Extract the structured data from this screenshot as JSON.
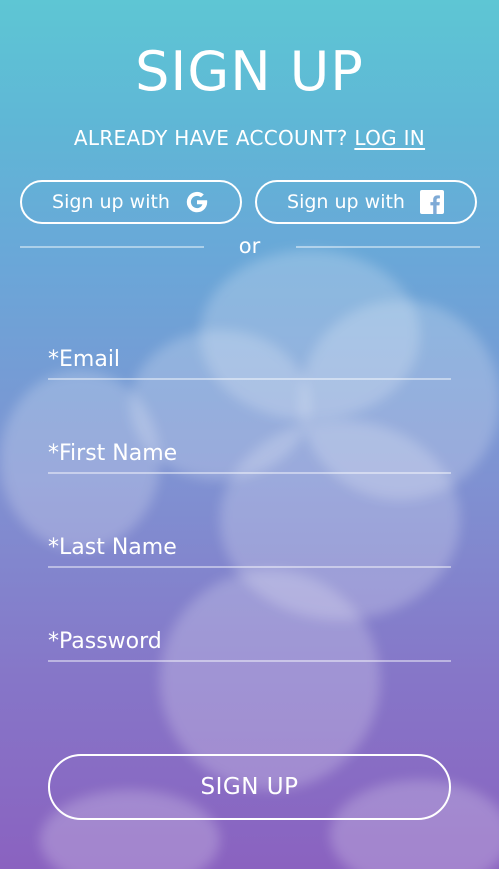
{
  "header": {
    "title": "SIGN UP",
    "already_text": "ALREADY HAVE ACCOUNT?",
    "login_link": "LOG IN"
  },
  "social": {
    "google_label": "Sign up with",
    "google_icon": "google-icon",
    "facebook_label": "Sign up with",
    "facebook_icon": "facebook-icon"
  },
  "divider": {
    "or_text": "or"
  },
  "form": {
    "email_placeholder": "*Email",
    "first_name_placeholder": "*First Name",
    "last_name_placeholder": "*Last Name",
    "password_placeholder": "*Password",
    "submit_label": "SIGN UP"
  },
  "colors": {
    "gradient_top": "#5ec6d4",
    "gradient_bottom": "#8a62c0",
    "text": "#ffffff"
  }
}
